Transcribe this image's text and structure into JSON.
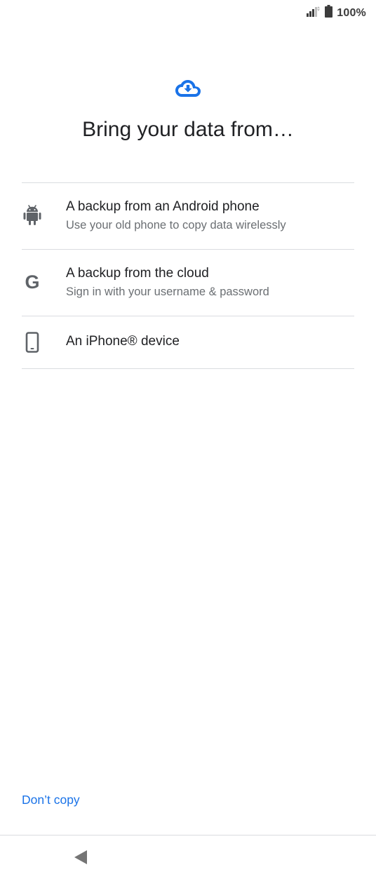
{
  "status_bar": {
    "battery_text": "100%",
    "icons": [
      "signal-icon",
      "battery-icon"
    ]
  },
  "hero": {
    "icon": "cloud-download-icon",
    "title": "Bring your data from…"
  },
  "options": [
    {
      "icon": "android-icon",
      "title": "A backup from an Android phone",
      "subtitle": "Use your old phone to copy data wirelessly"
    },
    {
      "icon": "google-icon",
      "icon_glyph": "G",
      "title": "A backup from the cloud",
      "subtitle": "Sign in with your username & password"
    },
    {
      "icon": "phone-icon",
      "title": "An iPhone® device"
    }
  ],
  "footer": {
    "dont_copy_label": "Don’t copy"
  },
  "nav": {
    "back_icon": "back-triangle-icon"
  },
  "colors": {
    "accent": "#1a73e8",
    "text_primary": "#202124",
    "text_secondary": "#6b6f73",
    "icon_gray": "#5f6368",
    "divider": "#dadce0"
  }
}
